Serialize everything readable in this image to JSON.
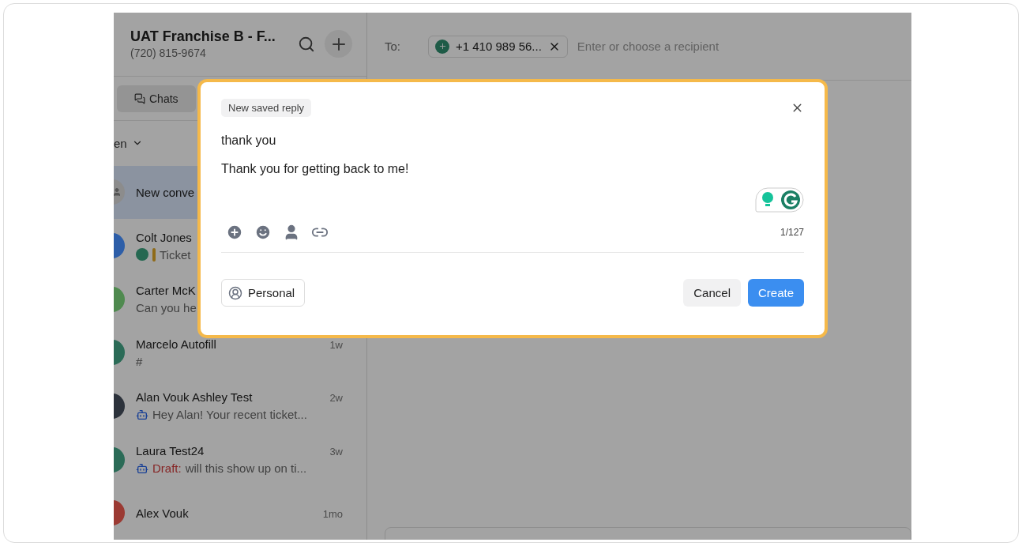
{
  "header": {
    "title": "UAT Franchise B - F...",
    "phone": "(720) 815-9674"
  },
  "tabs": [
    {
      "label": "Chats",
      "selected": true
    }
  ],
  "filter": {
    "label": "en"
  },
  "conversations": [
    {
      "name": "New conve",
      "color": "#8c8c8c",
      "kind": "new",
      "selected": true
    },
    {
      "name": "Colt Jones",
      "color": "#2d5ea8",
      "kind": "ticket",
      "preview": "Ticket",
      "selected": false
    },
    {
      "name": "Carter McK",
      "color": "#4f8a4f",
      "kind": "plain",
      "preview": "Can you he",
      "selected": false
    },
    {
      "name": "Marcelo Autofill",
      "color": "#2b6b57",
      "kind": "plain",
      "time": "1w",
      "preview": "#",
      "selected": false
    },
    {
      "name": "Alan Vouk Ashley Test",
      "color": "#2c323b",
      "kind": "bot",
      "time": "2w",
      "preview": "Hey Alan! Your recent ticket...",
      "selected": false
    },
    {
      "name": "Laura Test24",
      "color": "#2b6b57",
      "kind": "draft",
      "time": "3w",
      "draft": "Draft:",
      "preview": "will this show up on ti...",
      "selected": false
    },
    {
      "name": "Alex Vouk",
      "color": "#9b3a33",
      "kind": "plain",
      "time": "1mo",
      "selected": false
    }
  ],
  "recipient": {
    "label": "To:",
    "chip": "+1 410 989 56...",
    "placeholder": "Enter or choose a recipient"
  },
  "modal": {
    "tag": "New saved reply",
    "title": "thank you",
    "body": "Thank you for getting back to me!",
    "counter": "1/127",
    "visibility": "Personal",
    "buttons": [
      "Cancel",
      "Create"
    ]
  }
}
